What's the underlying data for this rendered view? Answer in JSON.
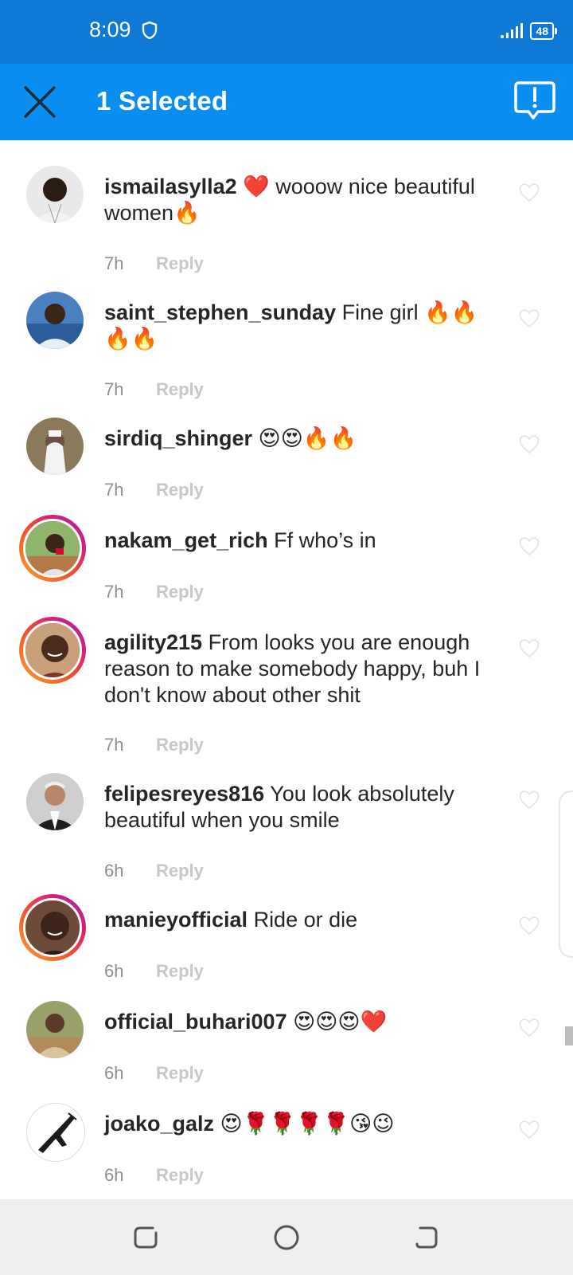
{
  "status_bar": {
    "time": "8:09",
    "battery": "48"
  },
  "action_bar": {
    "title": "1 Selected"
  },
  "comments": [
    {
      "username": "ismailasylla2",
      "text": " ❤️ wooow nice beautiful women🔥",
      "time": "7h",
      "reply": "Reply"
    },
    {
      "username": "saint_stephen_sunday",
      "text": " Fine girl 🔥🔥🔥🔥",
      "time": "7h",
      "reply": "Reply"
    },
    {
      "username": "sirdiq_shinger",
      "text": " 😍😍🔥🔥",
      "time": "7h",
      "reply": "Reply"
    },
    {
      "username": "nakam_get_rich",
      "text": " Ff who’s in",
      "time": "7h",
      "reply": "Reply"
    },
    {
      "username": "agility215",
      "text": " From looks you are enough reason to make somebody happy, buh I don't know about other shit",
      "time": "7h",
      "reply": "Reply"
    },
    {
      "username": "felipesreyes816",
      "text": " You look absolutely beautiful when you smile",
      "time": "6h",
      "reply": "Reply"
    },
    {
      "username": "manieyofficial",
      "text": " Ride or die",
      "time": "6h",
      "reply": "Reply"
    },
    {
      "username": "official_buhari007",
      "text": " 😍😍😍❤️",
      "time": "6h",
      "reply": "Reply"
    },
    {
      "username": "joako_galz",
      "text": " 😍🌹🌹🌹🌹😘😉",
      "time": "6h",
      "reply": "Reply"
    }
  ],
  "icons": {
    "close": "close-icon",
    "report": "report-icon",
    "heart": "heart-icon",
    "recents": "recents-icon",
    "home": "home-icon",
    "back": "back-icon"
  },
  "colors": {
    "status_bar": "#0f7ad6",
    "action_bar": "#0a8df0",
    "story_ring_start": "#f9a334",
    "story_ring_end": "#8a3ab9"
  }
}
